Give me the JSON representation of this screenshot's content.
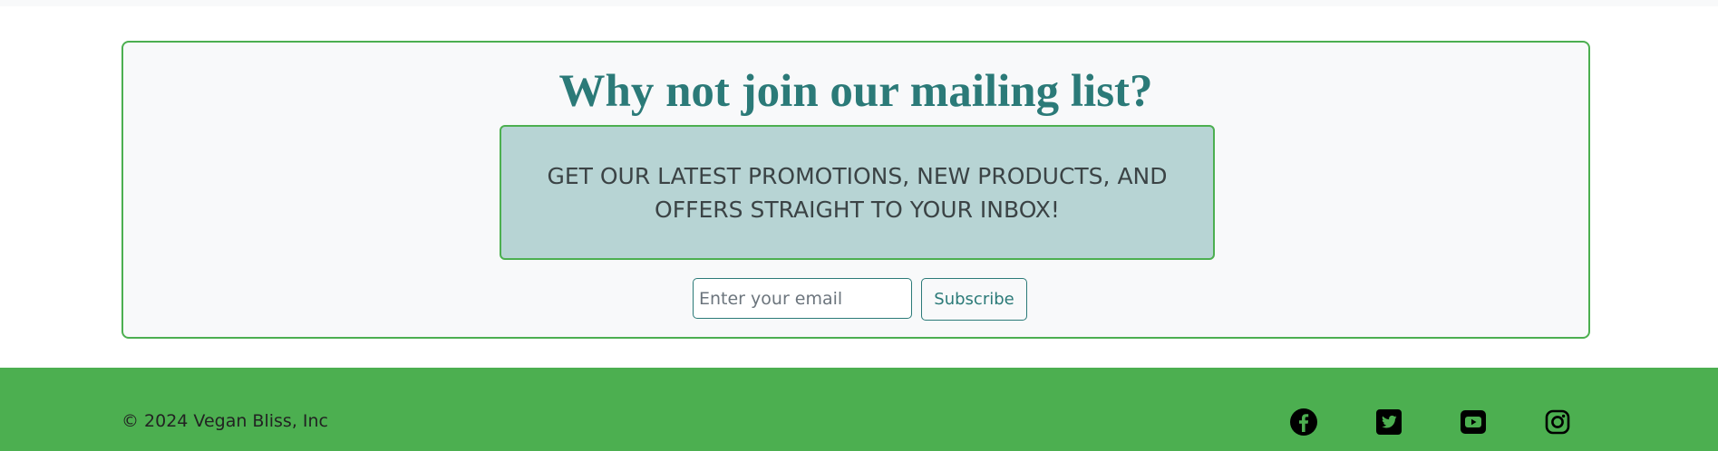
{
  "mailing": {
    "title": "Why not join our mailing list?",
    "promo_text": "GET OUR LATEST PROMOTIONS, NEW PRODUCTS, AND OFFERS STRAIGHT TO YOUR INBOX!",
    "email_placeholder": "Enter your email",
    "email_value": "",
    "subscribe_label": "Subscribe"
  },
  "footer": {
    "copyright": "© 2024 Vegan Bliss, Inc",
    "social_icons": [
      "facebook-icon",
      "twitter-icon",
      "youtube-icon",
      "instagram-icon"
    ]
  },
  "colors": {
    "accent_green": "#4caf50",
    "heading_teal": "#2b7a78",
    "promo_bg": "#b7d4d4",
    "panel_bg": "#f8f9fa",
    "icon_color": "#000000"
  }
}
